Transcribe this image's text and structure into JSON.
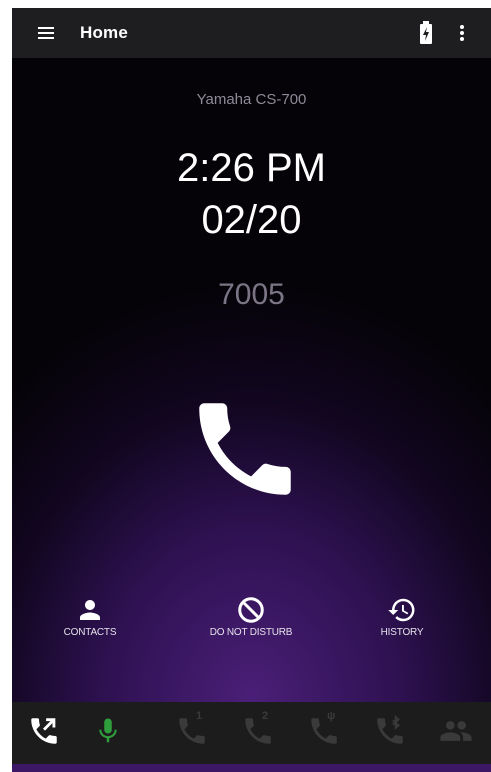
{
  "app_bar": {
    "title": "Home",
    "menu_icon": "hamburger-menu-icon",
    "battery_icon": "battery-charging-icon",
    "more_icon": "more-vertical-icon"
  },
  "status": {
    "device_name": "Yamaha CS-700",
    "time": "2:26 PM",
    "date": "02/20",
    "extension": "7005"
  },
  "call": {
    "icon": "phone-handset-icon"
  },
  "actions": [
    {
      "label": "CONTACTS",
      "icon": "person-icon"
    },
    {
      "label": "DO NOT DISTURB",
      "icon": "block-icon"
    },
    {
      "label": "HISTORY",
      "icon": "history-icon"
    }
  ],
  "bottom_tabs": [
    {
      "name": "call-transfer",
      "icon": "phone-forwarded-icon",
      "active": true
    },
    {
      "name": "microphone",
      "icon": "microphone-icon",
      "active": true
    },
    {
      "name": "line-1",
      "icon": "phone-line-icon",
      "badge": "1",
      "active": false
    },
    {
      "name": "line-2",
      "icon": "phone-line-icon",
      "badge": "2",
      "active": false
    },
    {
      "name": "usb-call",
      "icon": "phone-usb-icon",
      "badge": "ψ",
      "active": false
    },
    {
      "name": "bluetooth-call",
      "icon": "phone-bluetooth-icon",
      "active": false
    },
    {
      "name": "conference",
      "icon": "group-icon",
      "active": false
    }
  ],
  "colors": {
    "app_bar": "#1e1e20",
    "background_dark": "#050308",
    "purple_glow": "#4b1f78",
    "mic_active": "#2e9e3c",
    "tab_inactive": "#3a3a3b",
    "text_dim": "#8e8a96"
  }
}
